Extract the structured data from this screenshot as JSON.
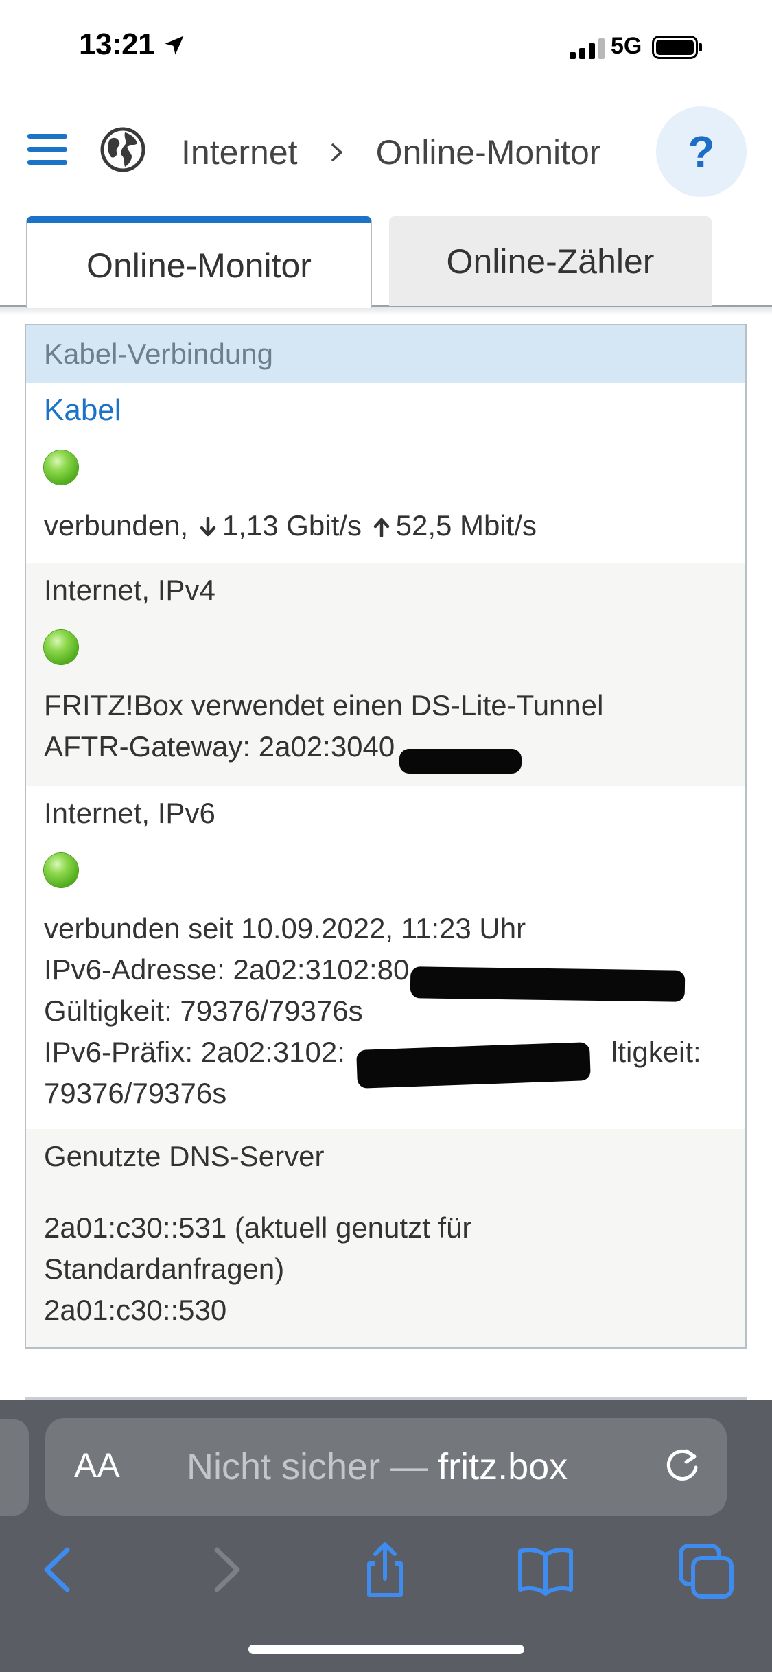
{
  "status_bar": {
    "time": "13:21",
    "network": "5G",
    "icons": [
      "location-arrow-icon",
      "signal-icon",
      "battery-icon"
    ]
  },
  "header": {
    "breadcrumb": [
      "Internet",
      "Online-Monitor"
    ],
    "help_label": "?",
    "icons": [
      "menu-icon",
      "globe-icon",
      "chevron-right-icon"
    ]
  },
  "tabs": [
    {
      "label": "Online-Monitor",
      "active": true
    },
    {
      "label": "Online-Zähler",
      "active": false
    }
  ],
  "panel": {
    "heading": "Kabel-Verbindung",
    "kabel": {
      "title": "Kabel",
      "status_prefix": "verbunden,",
      "down": "1,13 Gbit/s",
      "up": "52,5 Mbit/s"
    },
    "ipv4": {
      "title": "Internet, IPv4",
      "line1": "FRITZ!Box verwendet einen DS-Lite-Tunnel",
      "line2": "AFTR-Gateway: 2a02:3040"
    },
    "ipv6": {
      "title": "Internet, IPv6",
      "line1": "verbunden seit 10.09.2022, 11:23 Uhr",
      "line2": "IPv6-Adresse: 2a02:3102:80",
      "line3": "Gültigkeit: 79376/79376s",
      "line4_start": "IPv6-Präfix: 2a02:3102:",
      "line4_end": "ltigkeit:",
      "line5": "79376/79376s"
    },
    "dns": {
      "title": "Genutzte DNS-Server",
      "line1": "2a01:c30::531 (aktuell genutzt für",
      "line2": "Standardanfragen)",
      "line3": "2a01:c30::530"
    }
  },
  "browser": {
    "aa_label": "AA",
    "url_prefix": "Nicht sicher — ",
    "url_host": "fritz.box",
    "toolbar_icons": [
      "back-icon",
      "forward-icon",
      "share-icon",
      "bookmarks-icon",
      "tabs-icon"
    ],
    "colors": {
      "chrome": "#5a5e64",
      "accent": "#3f8cf0"
    }
  },
  "colors": {
    "accent_blue": "#1a73c7",
    "panel_head_bg": "#d5e6f4",
    "led_green": "#6cc42f"
  }
}
